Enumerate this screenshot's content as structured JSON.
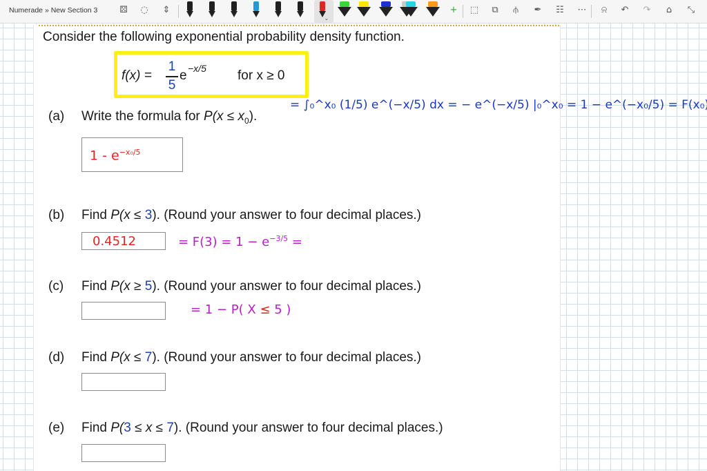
{
  "toolbar": {
    "breadcrumb": "Numerade » New Section 3",
    "colors": {
      "pen_1": "#1f1f1f",
      "pen_2": "#1f1f1f",
      "pen_3": "#1f1f1f",
      "pen_4": "#1f9bd7",
      "pen_5": "#1f1f1f",
      "pen_6": "#1f1f1f",
      "pen_selected": "#e0261e",
      "highlighter_1": "#3cd33c",
      "highlighter_2": "#ffe600",
      "highlighter_3": "#1e2fcf",
      "highlighter_4": "#c9c9c9",
      "highlighter_5": "#2ad4e8",
      "highlighter_6": "#ff9a1a"
    }
  },
  "question": {
    "intro": "Consider the following exponential probability density function.",
    "formula": {
      "lhs": "f(x) =",
      "numerator": "1",
      "denominator": "5",
      "base": "e",
      "exponent": "−x/5",
      "condition": "for x ≥ 0"
    },
    "parts": [
      {
        "label": "(a)",
        "prompt_pre": "Write the formula for ",
        "prompt_math": "P(x ≤ x",
        "prompt_sub": "0",
        "prompt_post": ").",
        "answer_value": "1 - e^(-x0/5)"
      },
      {
        "label": "(b)",
        "prompt_pre": "Find ",
        "prompt_math_a": "P(x ≤ ",
        "prompt_num": "3",
        "prompt_post": "). (Round your answer to four decimal places.)",
        "answer_value": "0.4512"
      },
      {
        "label": "(c)",
        "prompt_pre": "Find ",
        "prompt_math_a": "P(x ≥ ",
        "prompt_num": "5",
        "prompt_post": "). (Round your answer to four decimal places.)",
        "answer_value": ""
      },
      {
        "label": "(d)",
        "prompt_pre": "Find ",
        "prompt_math_a": "P(x ≤ ",
        "prompt_num": "7",
        "prompt_post": "). (Round your answer to four decimal places.)",
        "answer_value": ""
      },
      {
        "label": "(e)",
        "prompt_pre": "Find ",
        "prompt_math_a": "P(",
        "prompt_num": "3",
        "prompt_mid": " ≤ x ≤ ",
        "prompt_num2": "7",
        "prompt_post": "). (Round your answer to four decimal places.)",
        "answer_value": ""
      }
    ]
  },
  "annotations": {
    "colors": {
      "blue_ink": "#1a36c8",
      "red_ink": "#e0261e",
      "magenta_ink": "#b81fc9"
    },
    "part_a_work": "= ∫₀^x₀ (1/5) e^(−x/5) dx = − e^(−x/5) |₀^x₀ = 1 − e^(−x₀/5) = F(x₀)",
    "part_a_answer_main": "1 - e",
    "part_a_answer_exp": "−x₀/5",
    "part_b_answer": "0.4512",
    "part_b_work_main": "= F(3) = 1 − e",
    "part_b_work_exp": "−3/5",
    "part_b_work_tail": "=",
    "part_c_work_pre": "= 1 − P( X ",
    "part_c_work_sym": "≤",
    "part_c_work_post": " 5 )"
  }
}
